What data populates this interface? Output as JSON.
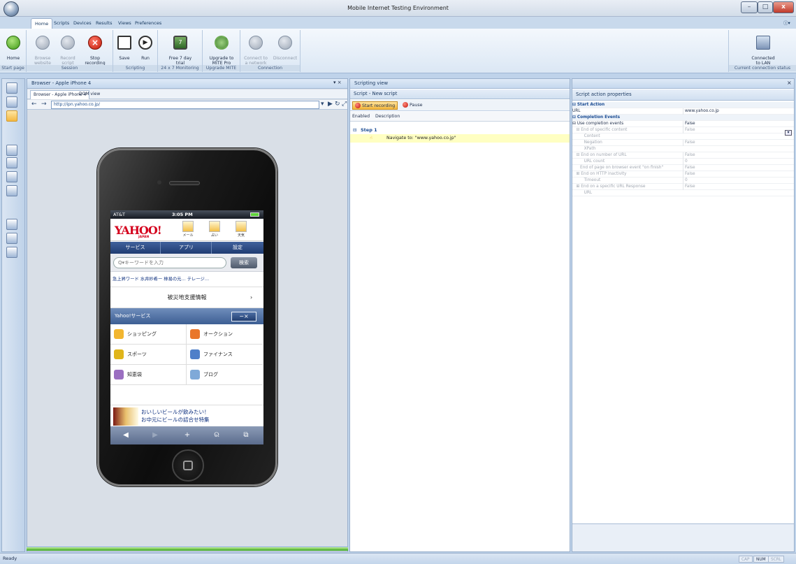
{
  "window": {
    "title": "Mobile Internet Testing Environment",
    "min": "–",
    "max": "□",
    "close": "x"
  },
  "tabs": [
    "Home",
    "Scripts",
    "Devices",
    "Results",
    "Views",
    "Preferences"
  ],
  "help_label": "ⓘ▾",
  "ribbon": {
    "start_page": {
      "label": "Start page",
      "home": "Home"
    },
    "session": {
      "label": "Session",
      "browse": "Browse\nwebsite",
      "record": "Record\nscript",
      "stop": "Stop\nrecording"
    },
    "scripting": {
      "label": "Scripting",
      "save": "Save",
      "run": "Run"
    },
    "monitoring": {
      "label": "24 x 7 Monitoring",
      "trial": "Free 7 day\ntrial"
    },
    "upgrade": {
      "label": "Upgrade MITE",
      "upgrade": "Upgrade to\nMITE Pro"
    },
    "connection": {
      "label": "Connection",
      "connect": "Connect to\na network",
      "disconnect": "Disconnect"
    },
    "status": {
      "label": "Current connection status",
      "connected": "Connected\nto LAN"
    }
  },
  "browser_panel": {
    "title": "Browser - Apple iPhone 4",
    "tabs": [
      "Browser - Apple iPhone 4",
      "DOM view"
    ],
    "url": "http://ipn.yahoo.co.jp/"
  },
  "phone": {
    "carrier": "AT&T",
    "time": "3:05 PM",
    "logo": "YAHOO!",
    "logo_sub": "JAPAN",
    "icons": [
      "メール",
      "占い",
      "天気"
    ],
    "nav": [
      "サービス",
      "アプリ",
      "設定"
    ],
    "search_placeholder": "Q▾キーワードを入力",
    "search_button": "検索",
    "ranking": "急上昇ワード  水井紗希ー  林易の元…  テレージ…",
    "disaster": "被災地支援情報",
    "services_header": "Yahoo!サービス",
    "services_close": "−×",
    "services": [
      "ショッピング",
      "オークション",
      "スポーツ",
      "ファイナンス",
      "知恵袋",
      "ブログ"
    ],
    "beer_line1": "おいしいビールが飲みたい！",
    "beer_line2": "お中元にビールの詰合せ特集",
    "toolbar": [
      "◀",
      "▶",
      "+",
      "ର",
      "⧉"
    ]
  },
  "scripting_panel": {
    "title": "Scripting view",
    "subtitle": "Script - New script",
    "start_recording": "Start recording",
    "pause": "Pause",
    "col_enabled": "Enabled",
    "col_description": "Description",
    "step": "Step 1",
    "action": "Navigate to: \"www.yahoo.co.jp\""
  },
  "props_panel": {
    "title": "Script action properties",
    "rows": [
      {
        "name": "⊟ Start Action",
        "value": "",
        "kind": "cat"
      },
      {
        "name": "URL",
        "value": "www.yahoo.co.jp",
        "kind": "norm"
      },
      {
        "name": "⊟ Completion Events",
        "value": "",
        "kind": "cat"
      },
      {
        "name": "⊟ Use completion events",
        "value": "False",
        "kind": "norm"
      },
      {
        "name": "   ⊟ End of specific content",
        "value": "False",
        "kind": "dis"
      },
      {
        "name": "         Content",
        "value": "",
        "kind": "dis"
      },
      {
        "name": "         Negation",
        "value": "False",
        "kind": "dis"
      },
      {
        "name": "         XPath",
        "value": "",
        "kind": "dis"
      },
      {
        "name": "   ⊟ End on number of URL",
        "value": "False",
        "kind": "dis"
      },
      {
        "name": "         URL count",
        "value": "0",
        "kind": "dis"
      },
      {
        "name": "      End of page on browser event \"on finish\"",
        "value": "False",
        "kind": "dis"
      },
      {
        "name": "   ⊞ End on HTTP inactivity",
        "value": "False",
        "kind": "dis"
      },
      {
        "name": "         Timeout",
        "value": "0",
        "kind": "dis"
      },
      {
        "name": "   ⊞ End on a specific URL Response",
        "value": "False",
        "kind": "dis"
      },
      {
        "name": "         URL",
        "value": "",
        "kind": "dis"
      }
    ]
  },
  "statusbar": {
    "text": "Ready",
    "caps": "CAP",
    "num": "NUM",
    "scrl": "SCRL"
  }
}
